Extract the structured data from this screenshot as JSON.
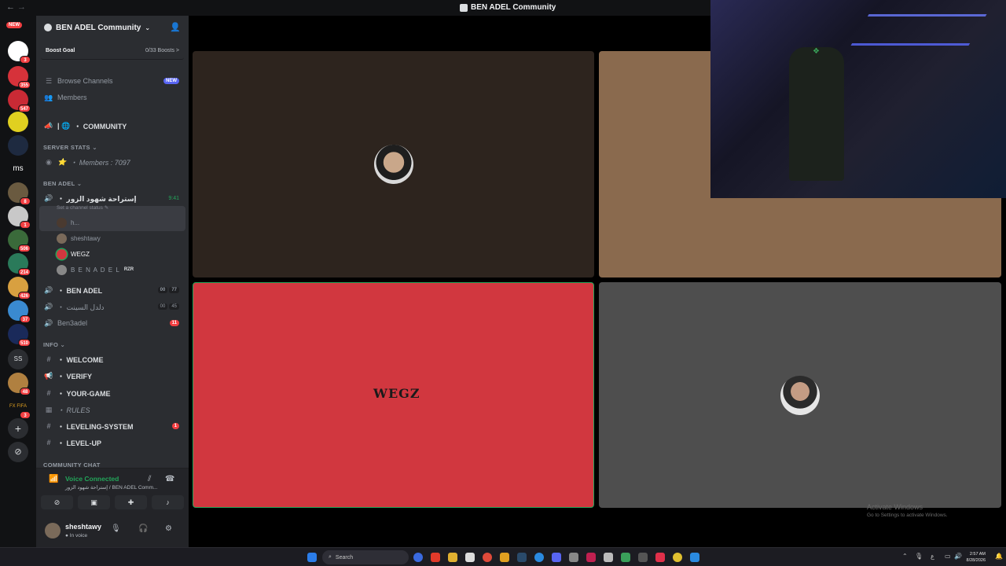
{
  "window": {
    "title": "BEN ADEL Community",
    "back": "←",
    "forward": "→"
  },
  "servers": {
    "new_label": "NEW",
    "badges": [
      "12",
      "3",
      "355",
      "547",
      "",
      "",
      "3",
      "8",
      "1",
      "506",
      "214",
      "426",
      "37",
      "510",
      "",
      "48",
      "3"
    ],
    "text_items": [
      "ms",
      "SS",
      "FX FIFA"
    ]
  },
  "guild": {
    "name": "BEN ADEL Community",
    "boost_goal": "Boost Goal",
    "boost_count": "0/33 Boosts",
    "boost_arrow": ">",
    "browse_channels": "Browse Channels",
    "browse_badge": "NEW",
    "members": "Members",
    "community_channel": "・ COMMUNITY",
    "server_stats_category": "SERVER STATS",
    "members_stat": "・ Members : 7097",
    "ben_adel_category": "BEN ADEL",
    "voice_active": {
      "name": "・ إستراحة شهود الزور",
      "time": "9:41",
      "status": "Set a channel status ✎",
      "members": [
        "h...",
        "sheshtawy",
        "WEGZ",
        "B E N A D E L"
      ],
      "tag": "RZR"
    },
    "voice_ben_adel": {
      "name": "・ BEN ADEL",
      "counts": [
        "00",
        "77"
      ]
    },
    "voice_arabic": {
      "name": "・ دلدل السينت",
      "counts": [
        "00",
        "45"
      ]
    },
    "ben3adel": {
      "name": "Ben3adel",
      "badge": "11"
    },
    "info_category": "INFO",
    "info_channels": [
      {
        "name": "・ WELCOME",
        "icon": "#"
      },
      {
        "name": "・ VERIFY",
        "icon": "📢"
      },
      {
        "name": "・ YOUR-GAME",
        "icon": "#"
      },
      {
        "name": "・ RULES",
        "icon": "▦"
      },
      {
        "name": "・ LEVELING-SYSTEM",
        "icon": "#",
        "badge": "1"
      },
      {
        "name": "・ LEVEL-UP",
        "icon": "#"
      }
    ],
    "community_chat_category": "COMMUNITY CHAT"
  },
  "voice_panel": {
    "status": "Voice Connected",
    "location": "إستراحة شهود الزور / BEN ADEL Comm..."
  },
  "user_panel": {
    "name": "sheshtawy",
    "status": "In voice"
  },
  "stage": {
    "wegz_logo": "WEGZ"
  },
  "watermark": {
    "title": "Activate Windows",
    "sub": "Go to Settings to activate Windows."
  },
  "taskbar": {
    "search_placeholder": "Search",
    "time": "2:57 AM",
    "date": "8/28/2026"
  },
  "colors": {
    "accent": "#5865f2",
    "danger": "#f23f42",
    "online": "#23a55a",
    "tile_speaking": "#d1373f"
  }
}
